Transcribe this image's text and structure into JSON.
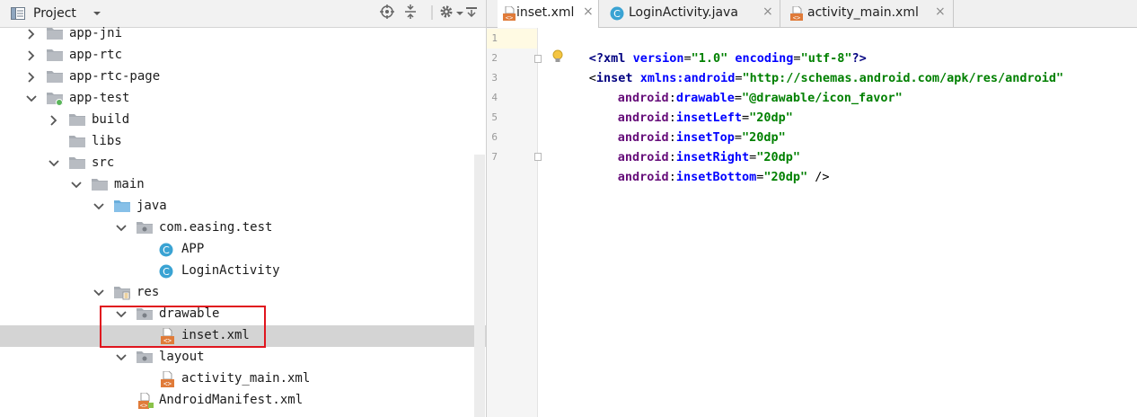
{
  "project_panel": {
    "title": "Project",
    "tree": [
      {
        "label": "app-jni",
        "depth": 0,
        "icon": "module-folder-icon",
        "arrow": "right"
      },
      {
        "label": "app-rtc",
        "depth": 0,
        "icon": "module-folder-icon",
        "arrow": "right"
      },
      {
        "label": "app-rtc-page",
        "depth": 0,
        "icon": "module-folder-icon",
        "arrow": "right"
      },
      {
        "label": "app-test",
        "depth": 0,
        "icon": "app-module-icon",
        "arrow": "down"
      },
      {
        "label": "build",
        "depth": 1,
        "icon": "folder-icon",
        "arrow": "right"
      },
      {
        "label": "libs",
        "depth": 1,
        "icon": "folder-icon",
        "arrow": ""
      },
      {
        "label": "src",
        "depth": 1,
        "icon": "folder-icon",
        "arrow": "down"
      },
      {
        "label": "main",
        "depth": 2,
        "icon": "folder-icon",
        "arrow": "down"
      },
      {
        "label": "java",
        "depth": 3,
        "icon": "source-folder-icon",
        "arrow": "down"
      },
      {
        "label": "com.easing.test",
        "depth": 4,
        "icon": "package-icon",
        "arrow": "down"
      },
      {
        "label": "APP",
        "depth": 5,
        "icon": "class-icon",
        "arrow": ""
      },
      {
        "label": "LoginActivity",
        "depth": 5,
        "icon": "class-icon",
        "arrow": ""
      },
      {
        "label": "res",
        "depth": 3,
        "icon": "resource-folder-icon",
        "arrow": "down"
      },
      {
        "label": "drawable",
        "depth": 4,
        "icon": "package-icon",
        "arrow": "down"
      },
      {
        "label": "inset.xml",
        "depth": 5,
        "icon": "xml-file-icon",
        "arrow": "",
        "selected": true
      },
      {
        "label": "layout",
        "depth": 4,
        "icon": "package-icon",
        "arrow": "down"
      },
      {
        "label": "activity_main.xml",
        "depth": 5,
        "icon": "xml-file-icon",
        "arrow": ""
      },
      {
        "label": "AndroidManifest.xml",
        "depth": 4,
        "icon": "manifest-file-icon",
        "arrow": ""
      }
    ]
  },
  "tabs": [
    {
      "label": "inset.xml",
      "icon": "xml-file-icon",
      "active": true
    },
    {
      "label": "LoginActivity.java",
      "icon": "class-icon",
      "active": false
    },
    {
      "label": "activity_main.xml",
      "icon": "xml-file-icon",
      "active": false
    }
  ],
  "tab_close_glyph": "×",
  "class_icon_letter": "C",
  "xml_icon_text": "<>",
  "code": {
    "line_numbers": [
      "1",
      "2",
      "3",
      "4",
      "5",
      "6",
      "7"
    ],
    "l1": {
      "a": "<?",
      "b": "xml ",
      "c": "version",
      "d": "=",
      "e": "\"1.0\"",
      "f": " ",
      "g": "encoding",
      "h": "=",
      "i": "\"utf-8\"",
      "j": "?>"
    },
    "l2": {
      "a": "<",
      "b": "inset ",
      "c": "xmlns:",
      "d": "android",
      "e": "=",
      "f": "\"http://schemas.android.com/apk/res/android\""
    },
    "l3": {
      "ns": "android",
      "sep": ":",
      "attr": "drawable",
      "eq": "=",
      "val": "\"@drawable/icon_favor\""
    },
    "l4": {
      "ns": "android",
      "sep": ":",
      "attr": "insetLeft",
      "eq": "=",
      "val": "\"20dp\""
    },
    "l5": {
      "ns": "android",
      "sep": ":",
      "attr": "insetTop",
      "eq": "=",
      "val": "\"20dp\""
    },
    "l6": {
      "ns": "android",
      "sep": ":",
      "attr": "insetRight",
      "eq": "=",
      "val": "\"20dp\""
    },
    "l7": {
      "ns": "android",
      "sep": ":",
      "attr": "insetBottom",
      "eq": "=",
      "val": "\"20dp\"",
      "end": " />"
    }
  },
  "colors": {
    "highlight_box": "#e0151e",
    "selected_row": "#d4d4d4",
    "xml_value": "#008000",
    "xml_attr": "#660e7a",
    "xml_tag": "#000080",
    "class_icon": "#3aa3d3",
    "xml_icon": "#e07b39"
  }
}
